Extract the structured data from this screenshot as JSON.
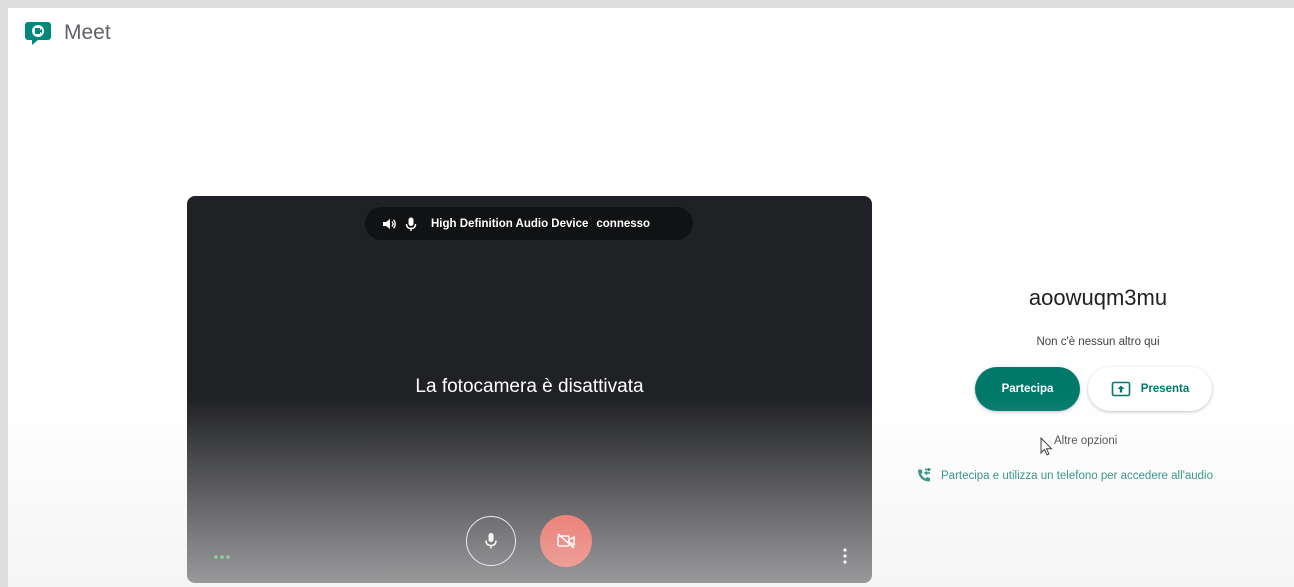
{
  "app": {
    "title": "Meet",
    "logo_icon": "google-meet-logo",
    "accent_color": "#00796b"
  },
  "preview": {
    "audio_status": {
      "speaker_icon": "speaker-icon",
      "mic_icon": "microphone-icon",
      "device": "High Definition Audio Device",
      "state": "connesso"
    },
    "camera_message": "La fotocamera è disattivata",
    "controls": {
      "mic_icon": "microphone-icon",
      "camera_icon": "camera-off-icon",
      "camera_button_color": "#ea4335",
      "more_icon": "more-vert-icon",
      "effects_icon": "dots-horizontal-icon"
    }
  },
  "join_panel": {
    "meeting_code": "aoowuqm3mu",
    "participants_text": "Non c'è nessun altro qui",
    "join_label": "Partecipa",
    "present_label": "Presenta",
    "present_icon": "present-screen-icon",
    "more_options_label": "Altre opzioni",
    "phone_label": "Partecipa e utilizza un telefono per accedere all'audio",
    "phone_icon": "phone-forward-icon"
  }
}
